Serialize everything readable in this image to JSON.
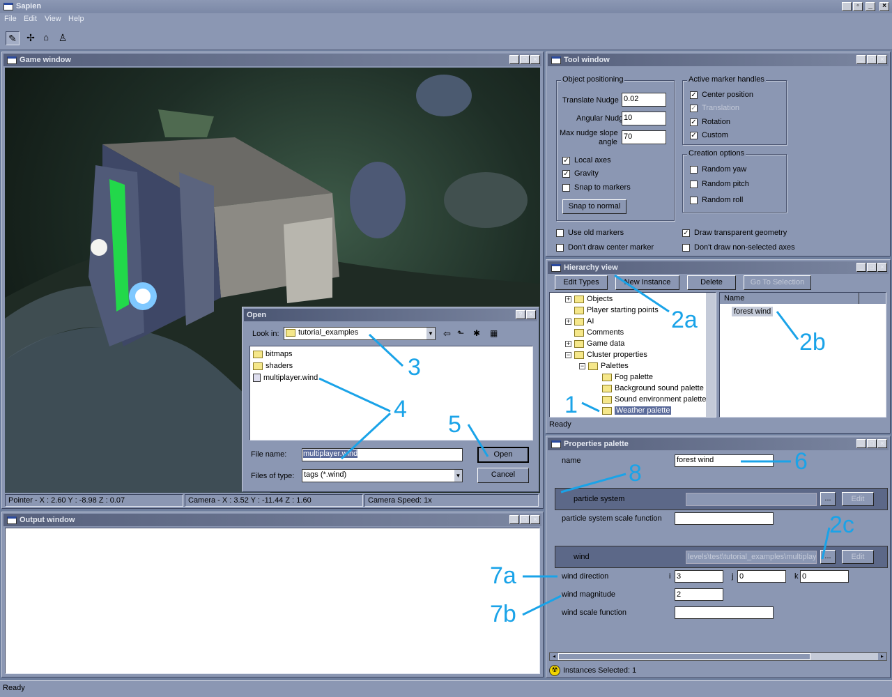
{
  "app": {
    "title": "Sapien",
    "menu": [
      "File",
      "Edit",
      "View",
      "Help"
    ]
  },
  "game_window": {
    "title": "Game window",
    "status": {
      "pointer": "Pointer - X : 2.60  Y : -8.98  Z : 0.07",
      "camera": "Camera - X : 3.52  Y : -11.44  Z : 1.60",
      "speed": "Camera Speed: 1x"
    }
  },
  "output_window": {
    "title": "Output window"
  },
  "tool_window": {
    "title": "Tool window",
    "object_positioning": {
      "label": "Object positioning",
      "translate_nudge_label": "Translate Nudge",
      "translate_nudge": "0.02",
      "angular_nudge_label": "Angular Nudge",
      "angular_nudge": "10",
      "max_nudge_label_1": "Max nudge slope",
      "max_nudge_label_2": "angle",
      "max_nudge": "70",
      "local_axes": "Local axes",
      "gravity": "Gravity",
      "snap_markers": "Snap to markers",
      "snap_normal": "Snap to normal"
    },
    "active_marker": {
      "label": "Active marker handles",
      "center": "Center position",
      "translation": "Translation",
      "rotation": "Rotation",
      "custom": "Custom"
    },
    "creation": {
      "label": "Creation options",
      "yaw": "Random yaw",
      "pitch": "Random pitch",
      "roll": "Random roll"
    },
    "use_old_markers": "Use old markers",
    "dont_draw_center": "Don't draw center marker",
    "draw_transparent": "Draw transparent geometry",
    "dont_draw_axes": "Don't draw non-selected axes"
  },
  "hierarchy": {
    "title": "Hierarchy view",
    "buttons": {
      "edit_types": "Edit Types",
      "new_instance": "New Instance",
      "delete": "Delete",
      "goto": "Go To Selection"
    },
    "tree": [
      "Objects",
      "Player starting points",
      "AI",
      "Comments",
      "Game data",
      "Cluster properties",
      "Palettes",
      "Fog palette",
      "Background sound palette",
      "Sound environment palette",
      "Weather palette"
    ],
    "list_header": "Name",
    "list_item": "forest wind",
    "status": "Ready"
  },
  "properties": {
    "title": "Properties palette",
    "name_label": "name",
    "name_value": "forest wind",
    "particle_system": "particle system",
    "particle_scale": "particle system scale function",
    "wind": "wind",
    "wind_path": "levels\\test\\tutorial_examples\\multiplay",
    "browse": "...",
    "edit": "Edit",
    "wind_direction": "wind direction",
    "i_label": "i",
    "j_label": "j",
    "k_label": "k",
    "i_val": "3",
    "j_val": "0",
    "k_val": "0",
    "wind_magnitude": "wind magnitude",
    "magnitude_val": "2",
    "wind_scale": "wind scale function",
    "instances": "Instances Selected: 1"
  },
  "open_dialog": {
    "title": "Open",
    "help": "?",
    "look_in_label": "Look in:",
    "look_in_value": "tutorial_examples",
    "files": [
      "bitmaps",
      "shaders",
      "multiplayer.wind"
    ],
    "file_name_label": "File name:",
    "file_name_value": "multiplayer.wind",
    "files_type_label": "Files of type:",
    "files_type_value": "tags (*.wind)",
    "open": "Open",
    "cancel": "Cancel"
  },
  "annotations": [
    "1",
    "2a",
    "2b",
    "2c",
    "3",
    "4",
    "5",
    "6",
    "7a",
    "7b",
    "8"
  ],
  "status_bar": "Ready",
  "colors": {
    "annotation": "#1aa3e8",
    "selection": "#5a6a9a"
  }
}
